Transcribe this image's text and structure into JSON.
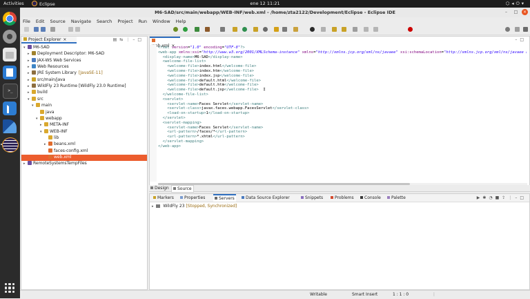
{
  "topbar": {
    "activities": "Activities",
    "app_name": "Eclipse",
    "clock": "ene 12  11:21"
  },
  "window": {
    "title": "M6-SAD/src/main/webapp/WEB-INF/web.xml - /home/zta2122/Development/Eclipse - Eclipse IDE"
  },
  "menu": [
    "File",
    "Edit",
    "Source",
    "Navigate",
    "Search",
    "Project",
    "Run",
    "Window",
    "Help"
  ],
  "project_explorer": {
    "tab_label": "Project Explorer",
    "items": [
      {
        "label": "M6-SAD",
        "deco": "",
        "twist": "▾",
        "icon": "project",
        "depth": 0
      },
      {
        "label": "Deployment Descriptor: M6-SAD",
        "deco": "",
        "twist": "▸",
        "icon": "descriptor",
        "depth": 1
      },
      {
        "label": "JAX-WS Web Services",
        "deco": "",
        "twist": "▸",
        "icon": "service",
        "depth": 1
      },
      {
        "label": "Web Resources",
        "deco": "",
        "twist": "▸",
        "icon": "web",
        "depth": 1
      },
      {
        "label": "JRE System Library",
        "deco": "[JavaSE-11]",
        "twist": "▸",
        "icon": "library",
        "depth": 1
      },
      {
        "label": "src/main/java",
        "deco": "",
        "twist": "▸",
        "icon": "srcfolder",
        "depth": 1
      },
      {
        "label": "WildFly 23 Runtime [WildFly 23.0 Runtime]",
        "deco": "",
        "twist": "▸",
        "icon": "library",
        "depth": 1
      },
      {
        "label": "build",
        "deco": "",
        "twist": "▸",
        "icon": "folder",
        "depth": 1
      },
      {
        "label": "src",
        "deco": "",
        "twist": "▾",
        "icon": "folder",
        "depth": 1
      },
      {
        "label": "main",
        "deco": "",
        "twist": "▾",
        "icon": "folder",
        "depth": 2
      },
      {
        "label": "java",
        "deco": "",
        "twist": "",
        "icon": "folder",
        "depth": 3
      },
      {
        "label": "webapp",
        "deco": "",
        "twist": "▾",
        "icon": "folder",
        "depth": 3
      },
      {
        "label": "META-INF",
        "deco": "",
        "twist": "▸",
        "icon": "folder",
        "depth": 4
      },
      {
        "label": "WEB-INF",
        "deco": "",
        "twist": "▾",
        "icon": "folder",
        "depth": 4
      },
      {
        "label": "lib",
        "deco": "",
        "twist": "",
        "icon": "folder",
        "depth": 5
      },
      {
        "label": "beans.xml",
        "deco": "",
        "twist": "▸",
        "icon": "xml",
        "depth": 5
      },
      {
        "label": "faces-config.xml",
        "deco": "",
        "twist": "",
        "icon": "xml",
        "depth": 5
      },
      {
        "label": "web.xml",
        "deco": "",
        "twist": "",
        "icon": "xml",
        "depth": 5,
        "selected": true
      },
      {
        "label": "RemoteSystemsTempFiles",
        "deco": "",
        "twist": "▸",
        "icon": "project",
        "depth": 0
      }
    ]
  },
  "editor": {
    "tab_label": "web.xml",
    "bottom_tabs": [
      "Design",
      "Source"
    ],
    "lines": [
      [
        [
          "tag",
          "<?xml "
        ],
        [
          "attr",
          "version"
        ],
        [
          "txt",
          "="
        ],
        [
          "str",
          "\"1.0\""
        ],
        [
          "txt",
          " "
        ],
        [
          "attr",
          "encoding"
        ],
        [
          "txt",
          "="
        ],
        [
          "str",
          "\"UTF-8\""
        ],
        [
          "tag",
          "?>"
        ]
      ],
      [
        [
          "tag",
          "<web-app "
        ],
        [
          "attr",
          "xmlns:xsi"
        ],
        [
          "txt",
          "="
        ],
        [
          "str",
          "\"http://www.w3.org/2001/XMLSchema-instance\""
        ],
        [
          "txt",
          " "
        ],
        [
          "attr",
          "xmlns"
        ],
        [
          "txt",
          "="
        ],
        [
          "str",
          "\"http://xmlns.jcp.org/xml/ns/javaee\""
        ],
        [
          "txt",
          " "
        ],
        [
          "attr",
          "xsi:schemaLocation"
        ],
        [
          "txt",
          "="
        ],
        [
          "str",
          "\"http://xmlns.jcp.org/xml/ns/javaee http://"
        ]
      ],
      [
        [
          "txt",
          "  "
        ],
        [
          "tag",
          "<display-name>"
        ],
        [
          "txt",
          "M6-SAD"
        ],
        [
          "tag",
          "</display-name>"
        ]
      ],
      [
        [
          "txt",
          "  "
        ],
        [
          "tag",
          "<welcome-file-list>"
        ]
      ],
      [
        [
          "txt",
          "    "
        ],
        [
          "tag",
          "<welcome-file>"
        ],
        [
          "txt",
          "index.html"
        ],
        [
          "tag",
          "</welcome-file>"
        ]
      ],
      [
        [
          "txt",
          "    "
        ],
        [
          "tag",
          "<welcome-file>"
        ],
        [
          "txt",
          "index.htm"
        ],
        [
          "tag",
          "</welcome-file>"
        ]
      ],
      [
        [
          "txt",
          "    "
        ],
        [
          "tag",
          "<welcome-file>"
        ],
        [
          "txt",
          "index.jsp"
        ],
        [
          "tag",
          "</welcome-file>"
        ]
      ],
      [
        [
          "txt",
          "    "
        ],
        [
          "tag",
          "<welcome-file>"
        ],
        [
          "txt",
          "default.html"
        ],
        [
          "tag",
          "</welcome-file>"
        ]
      ],
      [
        [
          "txt",
          "    "
        ],
        [
          "tag",
          "<welcome-file>"
        ],
        [
          "txt",
          "default.htm"
        ],
        [
          "tag",
          "</welcome-file>"
        ]
      ],
      [
        [
          "txt",
          "    "
        ],
        [
          "tag",
          "<welcome-file>"
        ],
        [
          "txt",
          "default.jsp"
        ],
        [
          "tag",
          "</welcome-file>"
        ],
        [
          "txt",
          "  I"
        ]
      ],
      [
        [
          "txt",
          "  "
        ],
        [
          "tag",
          "</welcome-file-list>"
        ]
      ],
      [
        [
          "txt",
          "  "
        ],
        [
          "tag",
          "<servlet>"
        ]
      ],
      [
        [
          "txt",
          "    "
        ],
        [
          "tag",
          "<servlet-name>"
        ],
        [
          "txt",
          "Faces Servlet"
        ],
        [
          "tag",
          "</servlet-name>"
        ]
      ],
      [
        [
          "txt",
          "    "
        ],
        [
          "tag",
          "<servlet-class>"
        ],
        [
          "txt",
          "javax.faces.webapp.FacesServlet"
        ],
        [
          "tag",
          "</servlet-class>"
        ]
      ],
      [
        [
          "txt",
          "    "
        ],
        [
          "tag",
          "<load-on-startup>"
        ],
        [
          "txt",
          "1"
        ],
        [
          "tag",
          "</load-on-startup>"
        ]
      ],
      [
        [
          "txt",
          "  "
        ],
        [
          "tag",
          "</servlet>"
        ]
      ],
      [
        [
          "txt",
          "  "
        ],
        [
          "tag",
          "<servlet-mapping>"
        ]
      ],
      [
        [
          "txt",
          "    "
        ],
        [
          "tag",
          "<servlet-name>"
        ],
        [
          "txt",
          "Faces Servlet"
        ],
        [
          "tag",
          "</servlet-name>"
        ]
      ],
      [
        [
          "txt",
          "    "
        ],
        [
          "tag",
          "<url-pattern>"
        ],
        [
          "txt",
          "/faces/*"
        ],
        [
          "tag",
          "</url-pattern>"
        ]
      ],
      [
        [
          "txt",
          "    "
        ],
        [
          "tag",
          "<url-pattern>"
        ],
        [
          "txt",
          "*.xhtml"
        ],
        [
          "tag",
          "</url-pattern>"
        ]
      ],
      [
        [
          "txt",
          "  "
        ],
        [
          "tag",
          "</servlet-mapping>"
        ]
      ],
      [
        [
          "tag",
          "</web-app>"
        ]
      ]
    ]
  },
  "bottom_panel": {
    "tabs": [
      "Markers",
      "Properties",
      "Servers",
      "Data Source Explorer",
      "Snippets",
      "Problems",
      "Console",
      "Palette"
    ],
    "active_tab": "Servers",
    "server_name": "WildFly 23",
    "server_status": "[Stopped, Synchronized]"
  },
  "status": {
    "writable": "Writable",
    "insert_mode": "Smart Insert",
    "position": "1 : 1 : 0"
  },
  "colors": {
    "selection": "#ec5d2e",
    "dock": "#2b2b2b",
    "topbar": "#1d1d1d"
  }
}
